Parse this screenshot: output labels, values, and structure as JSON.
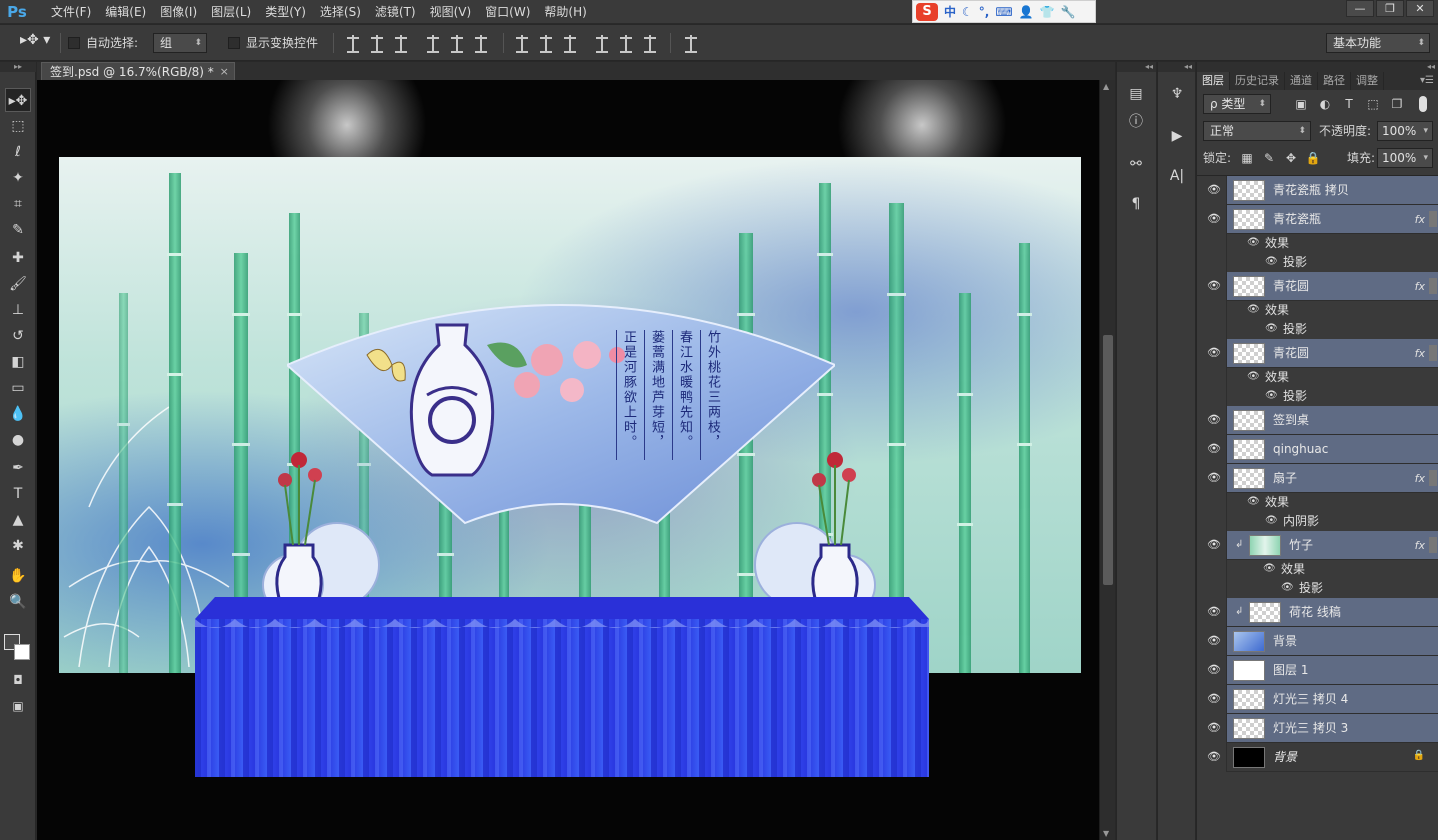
{
  "app": {
    "logo": "Ps"
  },
  "menus": [
    "文件(F)",
    "编辑(E)",
    "图像(I)",
    "图层(L)",
    "类型(Y)",
    "选择(S)",
    "滤镜(T)",
    "视图(V)",
    "窗口(W)",
    "帮助(H)"
  ],
  "ime": {
    "logo": "S",
    "mode": "中"
  },
  "window_controls": {
    "minimize": "—",
    "restore": "❐",
    "close": "✕"
  },
  "options": {
    "auto_select_label": "自动选择:",
    "auto_select_value": "组",
    "show_transform_label": "显示变换控件",
    "workspace": "基本功能"
  },
  "document": {
    "tab_title": "签到.psd @ 16.7%(RGB/8) *",
    "close": "×"
  },
  "artwork": {
    "poem": [
      "竹外桃花三两枝，",
      "春江水暖鸭先知。",
      "蒌蒿满地芦芽短，",
      "正是河豚欲上时。"
    ]
  },
  "panel": {
    "tabs": [
      "图层",
      "历史记录",
      "通道",
      "路径",
      "调整"
    ],
    "filter_kind": "ρ 类型",
    "blend_mode": "正常",
    "opacity_label": "不透明度:",
    "opacity_value": "100%",
    "lock_label": "锁定:",
    "fill_label": "填充:",
    "fill_value": "100%"
  },
  "layers": [
    {
      "name": "青花瓷瓶 拷贝",
      "thumb": "checker"
    },
    {
      "name": "青花瓷瓶",
      "thumb": "checker",
      "fx": "fx",
      "effects": [
        "投影"
      ]
    },
    {
      "name": "青花圆",
      "thumb": "checker",
      "fx": "fx",
      "effects": [
        "投影"
      ]
    },
    {
      "name": "青花圆",
      "thumb": "checker",
      "fx": "fx",
      "effects": [
        "投影"
      ]
    },
    {
      "name": "签到桌",
      "thumb": "checker"
    },
    {
      "name": "qinghuac",
      "thumb": "checker"
    },
    {
      "name": "扇子",
      "thumb": "checker",
      "fx": "fx",
      "effects": [
        "内阴影"
      ]
    },
    {
      "name": "竹子",
      "thumb": "bamboo",
      "fx": "fx",
      "clipped": true,
      "effects": [
        "投影"
      ]
    },
    {
      "name": "荷花 线稿",
      "thumb": "checker",
      "clipped": true
    },
    {
      "name": "背景",
      "thumb": "blue"
    },
    {
      "name": "图层 1",
      "thumb": "white"
    },
    {
      "name": "灯光三 拷贝 4",
      "thumb": "checker"
    },
    {
      "name": "灯光三 拷贝 3",
      "thumb": "checker"
    },
    {
      "name": "背景",
      "thumb": "black",
      "locked": true
    }
  ],
  "effects_label": "效果"
}
